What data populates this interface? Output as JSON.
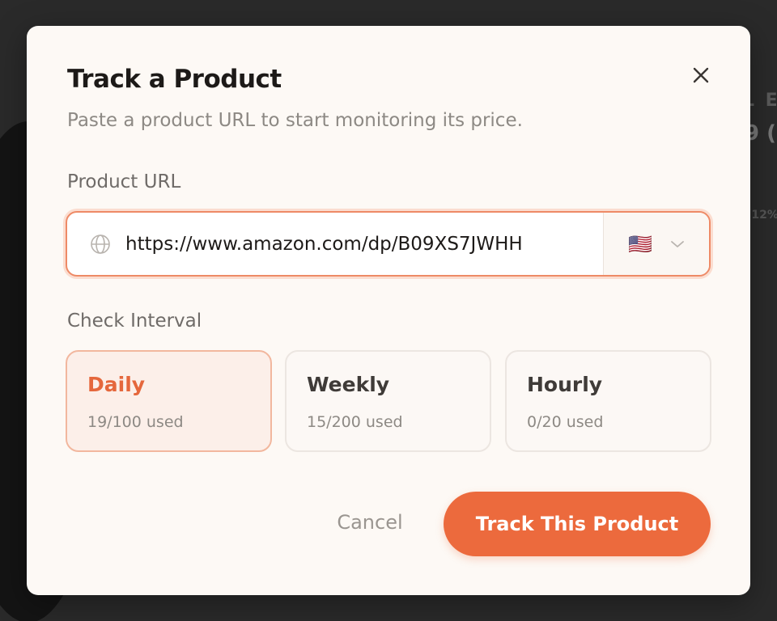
{
  "background": {
    "fragment_1": "L E",
    "fragment_2": "9 (",
    "fragment_3": "(12%"
  },
  "modal": {
    "title": "Track a Product",
    "subtitle": "Paste a product URL to start monitoring its price.",
    "close_icon": "close-icon",
    "url_field": {
      "label": "Product URL",
      "value": "https://www.amazon.com/dp/B09XS7JWHH",
      "icon": "globe-icon",
      "country_flag": "🇺🇸",
      "country_icon": "chevron-down-icon"
    },
    "interval": {
      "label": "Check Interval",
      "options": [
        {
          "name": "Daily",
          "usage": "19/100 used",
          "selected": true
        },
        {
          "name": "Weekly",
          "usage": "15/200 used",
          "selected": false
        },
        {
          "name": "Hourly",
          "usage": "0/20 used",
          "selected": false
        }
      ]
    },
    "actions": {
      "cancel_label": "Cancel",
      "submit_label": "Track This Product"
    }
  },
  "colors": {
    "accent": "#ec6a3d",
    "modal_background": "#fdf9f5",
    "selected_card_background": "#fcefe9"
  }
}
